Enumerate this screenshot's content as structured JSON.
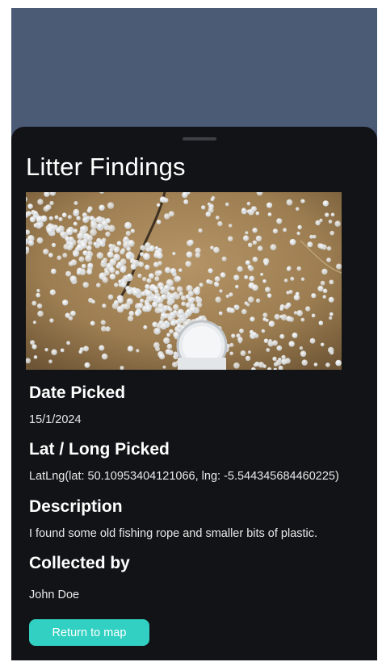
{
  "sheet": {
    "title": "Litter Findings",
    "image_alt": "Plastic pellets (nurdles) on sand"
  },
  "details": {
    "date_heading": "Date Picked",
    "date_value": "15/1/2024",
    "latlng_heading": "Lat / Long Picked",
    "latlng_value": "LatLng(lat: 50.10953404121066, lng: -5.544345684460225)",
    "description_heading": "Description",
    "description_value": "I found some old fishing rope and smaller bits of plastic.",
    "collector_heading": "Collected by",
    "collector_value": "John Doe"
  },
  "actions": {
    "return_label": "Return to map"
  },
  "colors": {
    "background_overlay": "#4b5a75",
    "sheet": "#121316",
    "accent": "#31d0c2"
  }
}
